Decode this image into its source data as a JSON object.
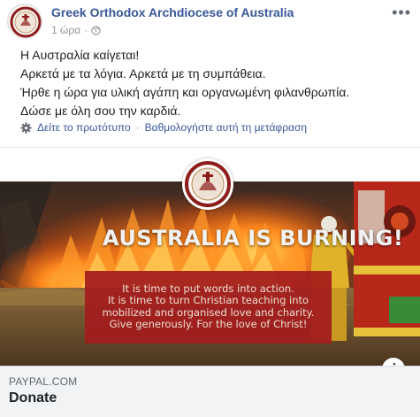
{
  "post": {
    "page_name": "Greek Orthodox Archdiocese of Australia",
    "timestamp": "1 ώρα",
    "separator": "·",
    "privacy_icon": "globe-icon",
    "more_label": "•••",
    "lines": [
      "Η Αυστραλία καίγεται!",
      "Αρκετά με τα λόγια. Αρκετά με τη συμπάθεια.",
      "Ήρθε η ώρα για υλική αγάπη και οργανωμένη φιλανθρωπία.",
      "Δώσε με όλη σου την καρδιά."
    ],
    "translate": {
      "icon": "gear-icon",
      "see_original": "Δείτε το πρωτότυπο",
      "separator": "·",
      "rate_translation": "Βαθμολογήστε αυτή τη μετάφραση"
    }
  },
  "image": {
    "headline": "AUSTRALIA IS BURNING!",
    "message_lines": [
      "It is time to put words into action.",
      "It is time to turn Christian teaching into",
      "mobilized and organised love and charity.",
      "Give generously. For the love of Christ!"
    ],
    "info_label": "i"
  },
  "link": {
    "domain": "PAYPAL.COM",
    "title": "Donate"
  },
  "colors": {
    "link_blue": "#385898",
    "red_box": "#a31d1d",
    "meta_gray": "#90949c",
    "preview_bg": "#f2f3f5"
  }
}
